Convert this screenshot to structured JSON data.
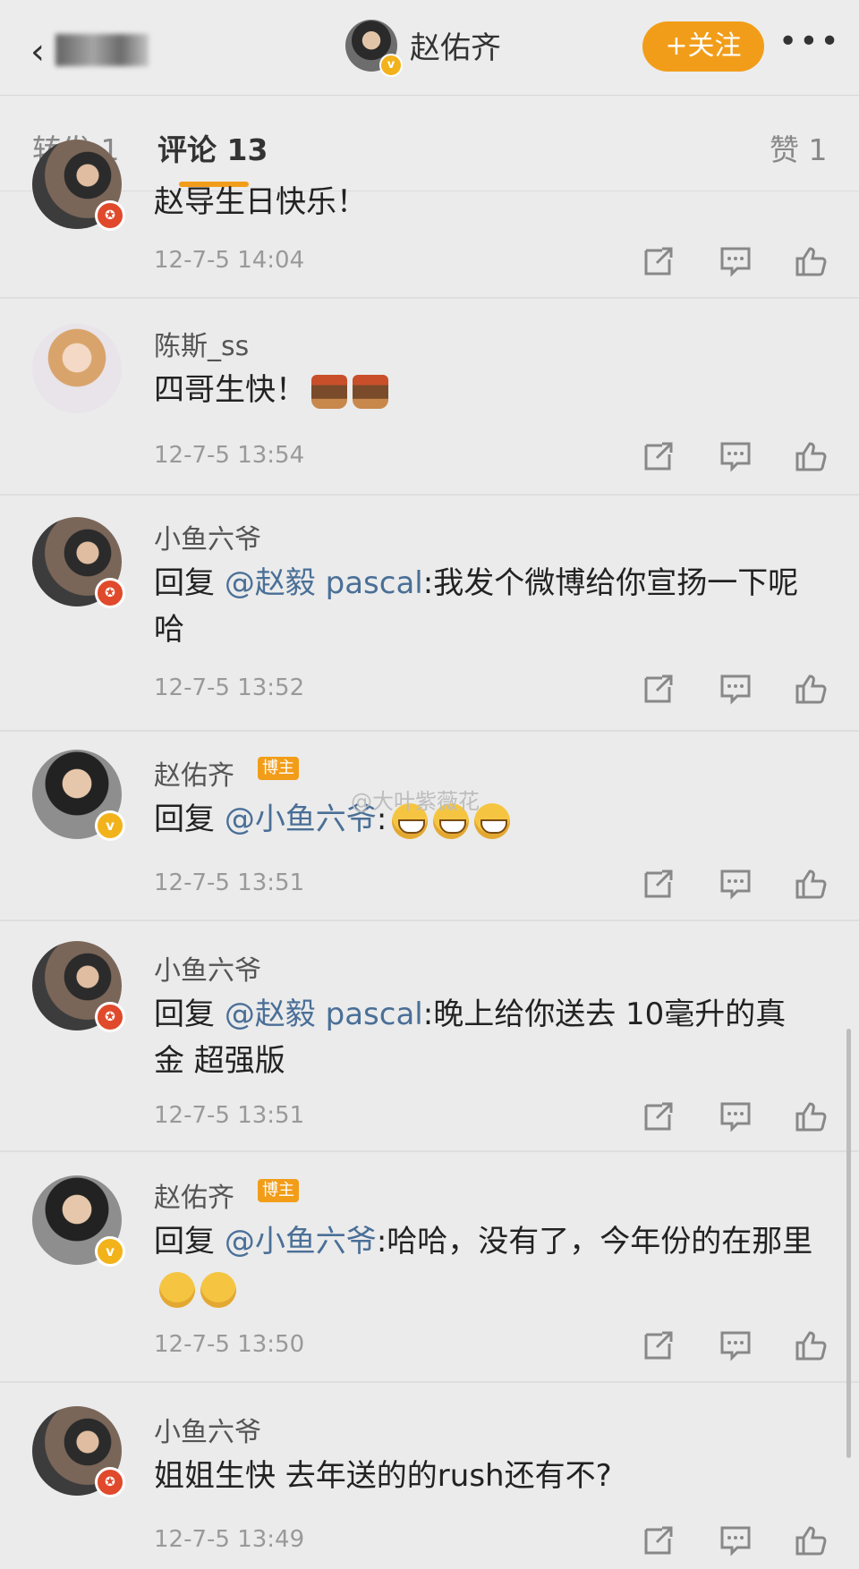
{
  "header": {
    "title": "赵佑齐",
    "follow_label": "+关注",
    "more_label": "•••"
  },
  "tabs": {
    "repost": "转发 1",
    "comments": "评论 13",
    "likes": "赞 1"
  },
  "watermark": "@大叶紫薇花",
  "comments": [
    {
      "user": "",
      "text": "赵导生日快乐！",
      "time": "12-7-5 14:04",
      "badge": "red"
    },
    {
      "user": "陈斯_ss",
      "text": "四哥生快！",
      "time": "12-7-5 13:54",
      "emojis": [
        "cake",
        "cake"
      ]
    },
    {
      "user": "小鱼六爷",
      "reply_prefix": "回复",
      "mention": "@赵毅 pascal",
      "text": ":我发个微博给你宣扬一下呢哈",
      "time": "12-7-5 13:52",
      "badge": "red"
    },
    {
      "user": "赵佑齐",
      "tag": "博主",
      "reply_prefix": "回复",
      "mention": "@小鱼六爷",
      "text": ":",
      "time": "12-7-5 13:51",
      "badge": "v",
      "emojis": [
        "grin",
        "grin",
        "grin"
      ]
    },
    {
      "user": "小鱼六爷",
      "reply_prefix": "回复",
      "mention": "@赵毅 pascal",
      "text": ":晚上给你送去 10毫升的真金 超强版",
      "time": "12-7-5 13:51",
      "badge": "red"
    },
    {
      "user": "赵佑齐",
      "tag": "博主",
      "reply_prefix": "回复",
      "mention": "@小鱼六爷",
      "text": ":哈哈，没有了，今年份的在那里",
      "time": "12-7-5 13:50",
      "badge": "v",
      "emojis": [
        "hmm",
        "hmm"
      ]
    },
    {
      "user": "小鱼六爷",
      "text": "姐姐生快 去年送的的rush还有不?",
      "time": "12-7-5 13:49",
      "badge": "red"
    }
  ],
  "colors": {
    "accent": "#f29d19",
    "mention": "#4a6f97",
    "background": "#ebebeb"
  }
}
